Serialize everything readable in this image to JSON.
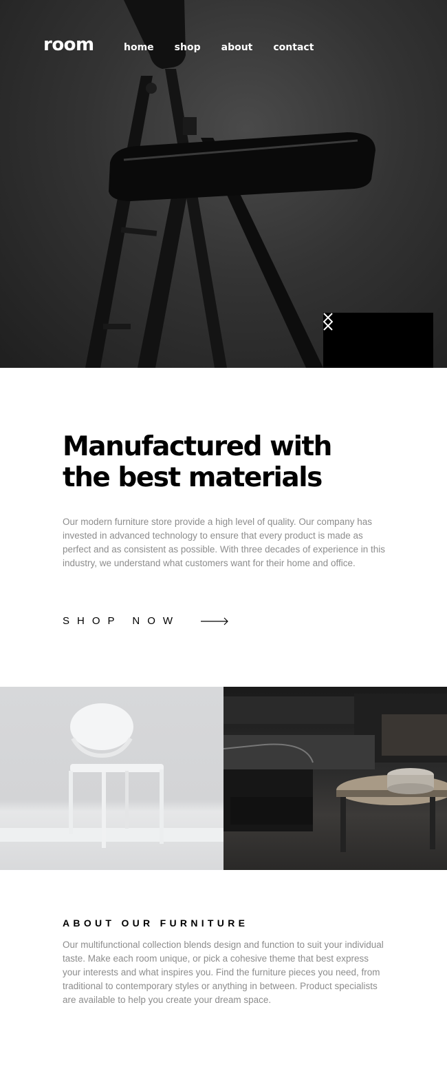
{
  "header": {
    "logo": "room",
    "nav": [
      {
        "label": "home"
      },
      {
        "label": "shop"
      },
      {
        "label": "about"
      },
      {
        "label": "contact"
      }
    ]
  },
  "hero": {
    "image": "black folding chair",
    "controls": {
      "prev_icon": "chevron-left-icon",
      "next_icon": "chevron-right-icon"
    }
  },
  "intro": {
    "title": "Manufactured with the best materials",
    "body": "Our modern furniture store provide a high level of quality. Our company has invested in advanced technology to ensure that every product is made as perfect and as consistent as possible. With three decades of experience in this industry, we understand what customers want for their home and office.",
    "cta": "SHOP NOW",
    "cta_icon": "arrow-right-icon"
  },
  "gallery": {
    "left_image": "white chair",
    "right_image": "dark living room"
  },
  "about": {
    "title": "ABOUT OUR FURNITURE",
    "body": "Our multifunctional collection blends design and function to suit your individual taste. Make each room unique, or pick a cohesive theme that best express your interests and what inspires you. Find the furniture pieces you need, from traditional to contemporary styles or anything in between. Product specialists are available to help you create your dream space."
  },
  "colors": {
    "text": "#000000",
    "muted": "#8c8c8c",
    "control_bg": "#000000"
  }
}
